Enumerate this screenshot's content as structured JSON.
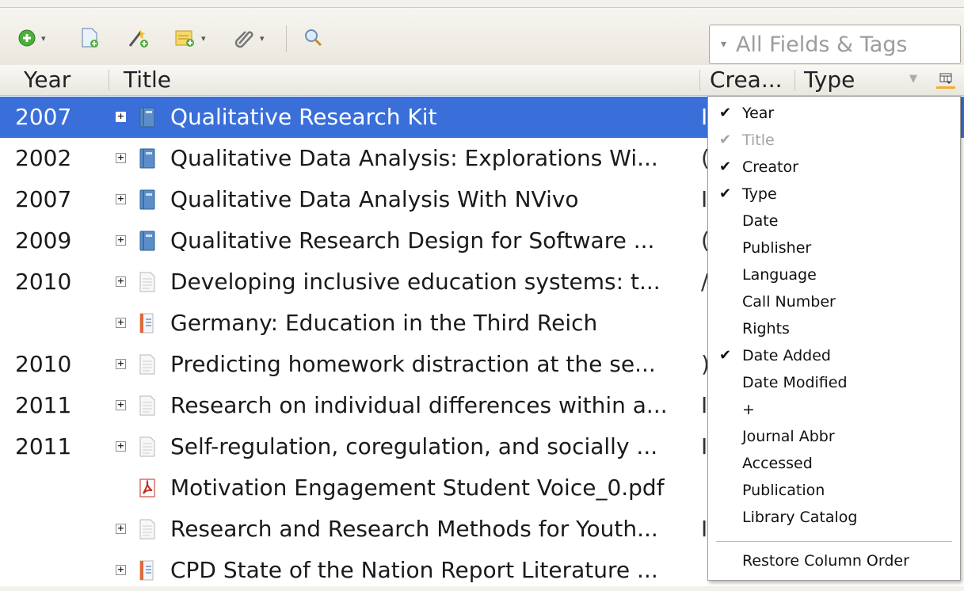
{
  "toolbar": {
    "search_placeholder": "All Fields & Tags"
  },
  "columns": {
    "year": "Year",
    "title": "Title",
    "creator": "Crea...",
    "type": "Type"
  },
  "rows": [
    {
      "year": "2007",
      "title": "Qualitative Research Kit",
      "cut": "I",
      "icon": "book-icon",
      "selected": true
    },
    {
      "year": "2002",
      "title": "Qualitative Data Analysis: Explorations Wi...",
      "cut": "(",
      "icon": "book-icon"
    },
    {
      "year": "2007",
      "title": "Qualitative Data Analysis With NVivo",
      "cut": "I",
      "icon": "book-icon"
    },
    {
      "year": "2009",
      "title": "Qualitative Research Design for Software ...",
      "cut": "(",
      "icon": "book-icon"
    },
    {
      "year": "2010",
      "title": "Developing inclusive education systems: t...",
      "cut": "/",
      "icon": "journal-article-icon"
    },
    {
      "year": "",
      "title": "Germany: Education in the Third Reich",
      "cut": "",
      "icon": "report-icon"
    },
    {
      "year": "2010",
      "title": "Predicting homework distraction at the se...",
      "cut": ")",
      "icon": "journal-article-icon"
    },
    {
      "year": "2011",
      "title": "Research on individual differences within a...",
      "cut": "I",
      "icon": "journal-article-icon"
    },
    {
      "year": "2011",
      "title": "Self-regulation, coregulation, and socially ...",
      "cut": "I",
      "icon": "journal-article-icon"
    },
    {
      "year": "",
      "title": "Motivation Engagement Student Voice_0.pdf",
      "cut": "",
      "icon": "pdf-icon"
    },
    {
      "year": "",
      "title": "Research and Research Methods for Youth...",
      "cut": "I",
      "icon": "journal-article-icon"
    },
    {
      "year": "",
      "title": "CPD State of the Nation Report Literature ...",
      "cut": "",
      "icon": "report-icon"
    }
  ],
  "menu": {
    "items": [
      {
        "label": "Year",
        "checked": true
      },
      {
        "label": "Title",
        "checked": true,
        "disabled": true
      },
      {
        "label": "Creator",
        "checked": true
      },
      {
        "label": "Type",
        "checked": true
      },
      {
        "label": "Date",
        "checked": false
      },
      {
        "label": "Publisher",
        "checked": false
      },
      {
        "label": "Language",
        "checked": false
      },
      {
        "label": "Call Number",
        "checked": false
      },
      {
        "label": "Rights",
        "checked": false
      },
      {
        "label": "Date Added",
        "checked": true
      },
      {
        "label": "Date Modified",
        "checked": false
      },
      {
        "label": "+",
        "checked": false
      },
      {
        "label": "Journal Abbr",
        "checked": false
      },
      {
        "label": "Accessed",
        "checked": false
      },
      {
        "label": "Publication",
        "checked": false
      },
      {
        "label": "Library Catalog",
        "checked": false
      }
    ],
    "restore_label": "Restore Column Order",
    "check_glyph": "✔"
  },
  "colors": {
    "selection": "#3a6fd9",
    "accent": "#f0b030"
  }
}
